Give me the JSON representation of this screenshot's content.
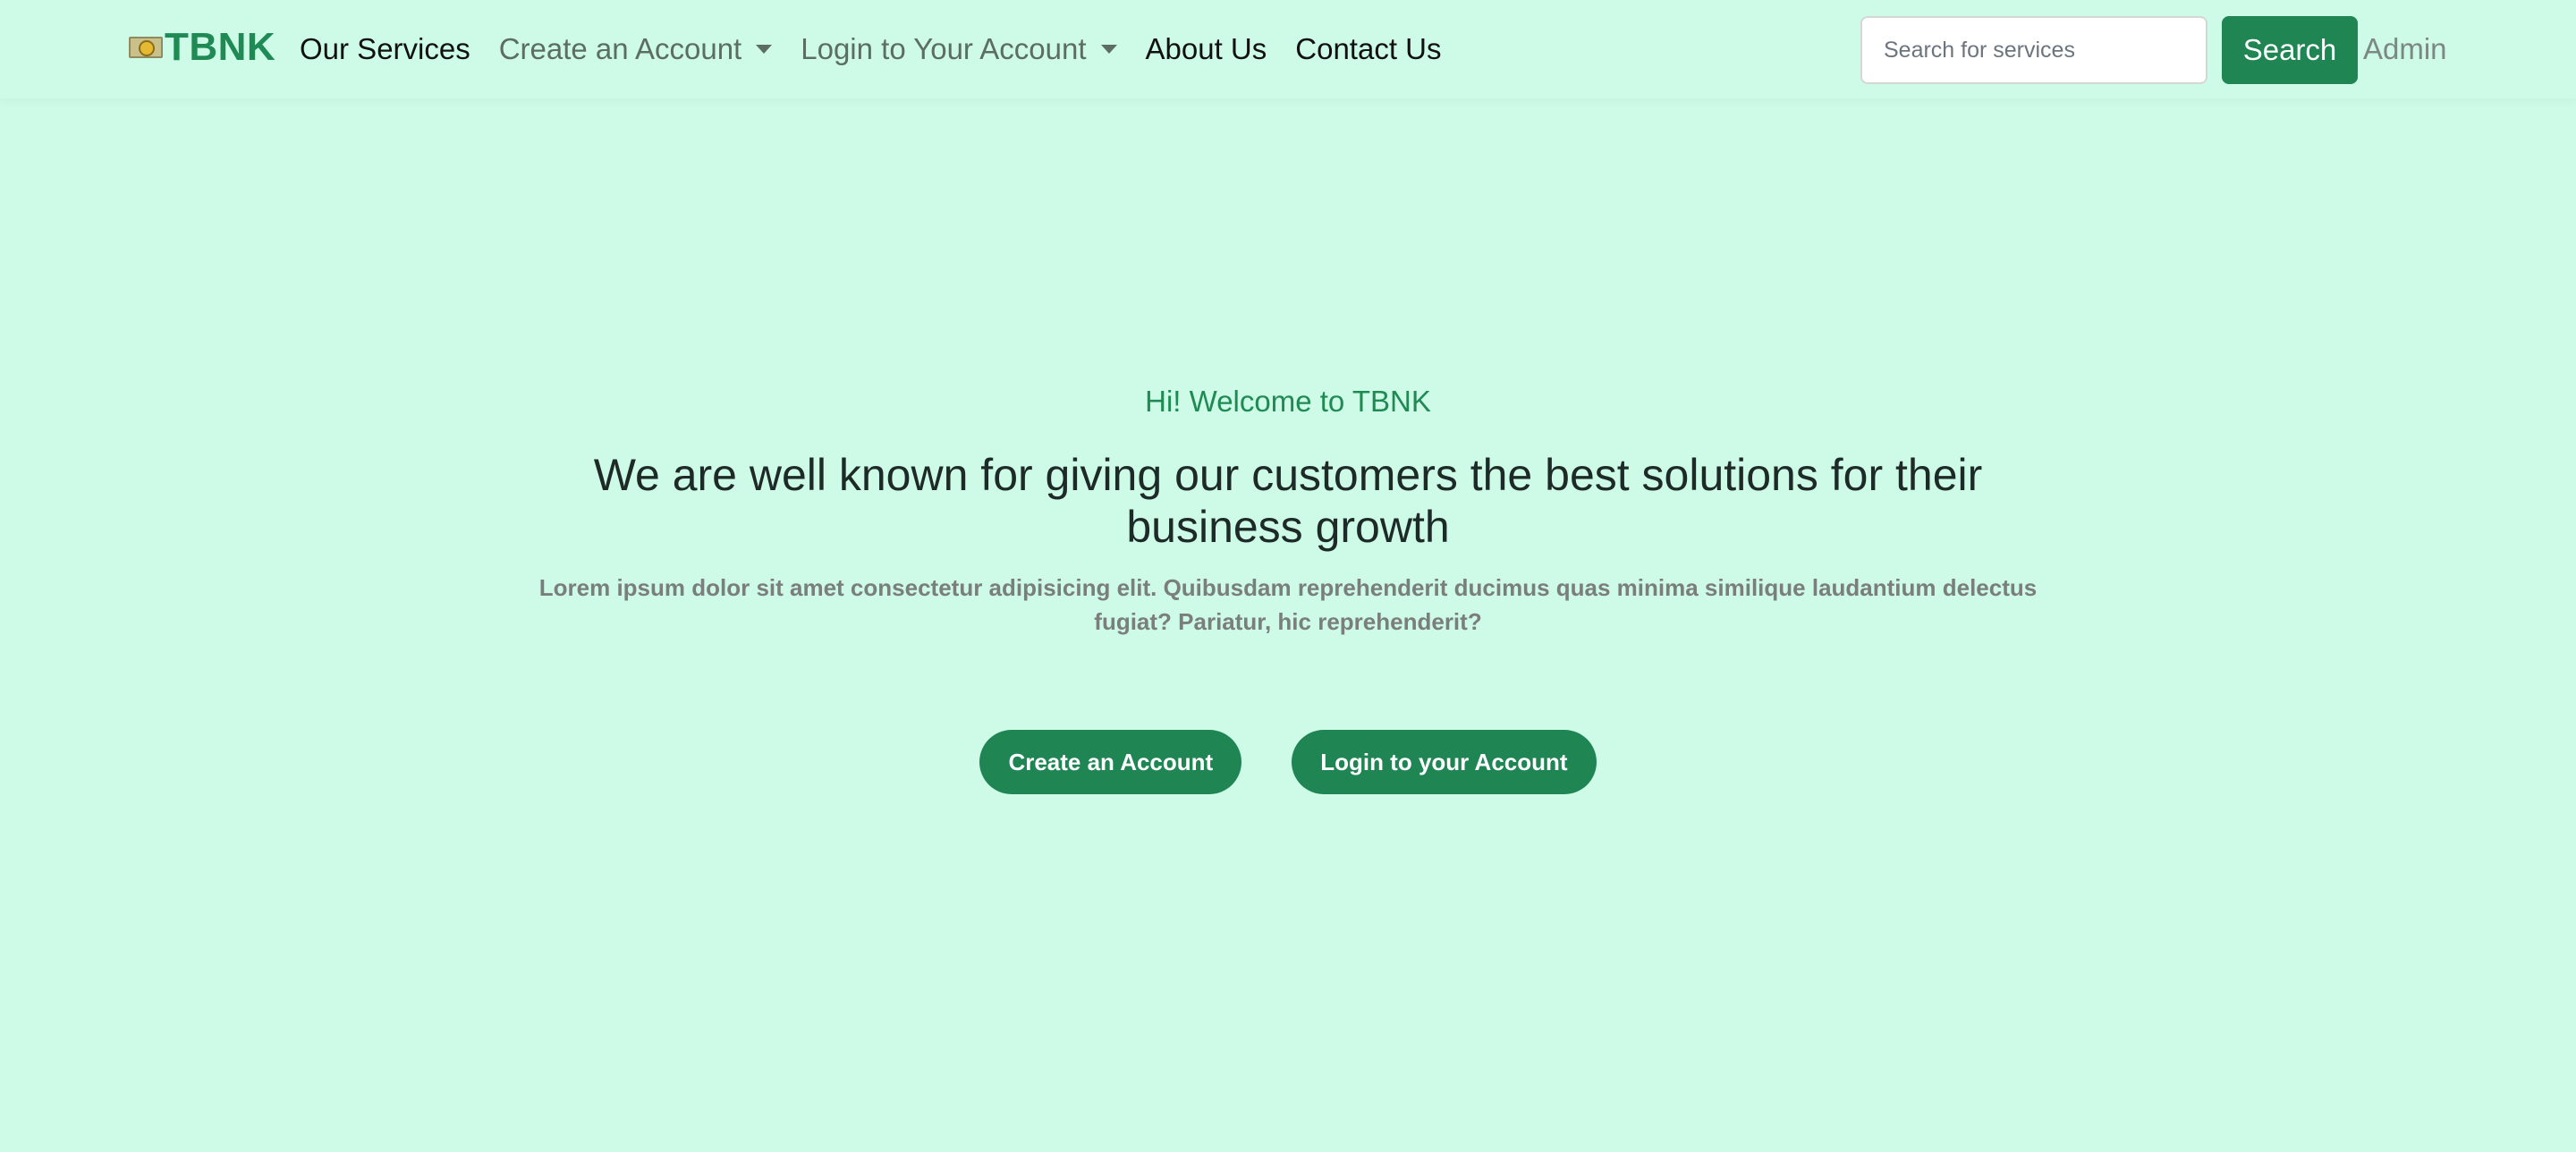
{
  "brand": {
    "name": "TBNK",
    "logo_icon": "money-bill-icon"
  },
  "nav": {
    "items": [
      {
        "label": "Our Services"
      },
      {
        "label": "Create an Account"
      },
      {
        "label": "Login to Your Account"
      },
      {
        "label": "About Us"
      },
      {
        "label": "Contact Us"
      }
    ],
    "admin_label": "Admin"
  },
  "search": {
    "placeholder": "Search for services",
    "value": "",
    "button_label": "Search"
  },
  "hero": {
    "kicker": "Hi! Welcome to TBNK",
    "title": "We are well known for giving our customers the best solutions for their business growth",
    "subtitle": "Lorem ipsum dolor sit amet consectetur adipisicing elit. Quibusdam reprehenderit ducimus quas minima similique laudantium delectus fugiat? Pariatur, hic reprehenderit?",
    "primary_button": "Create an Account",
    "secondary_button": "Login to your Account"
  },
  "colors": {
    "background": "#cdfbe7",
    "accent": "#1e8553",
    "brand_text": "#1f8a53"
  }
}
